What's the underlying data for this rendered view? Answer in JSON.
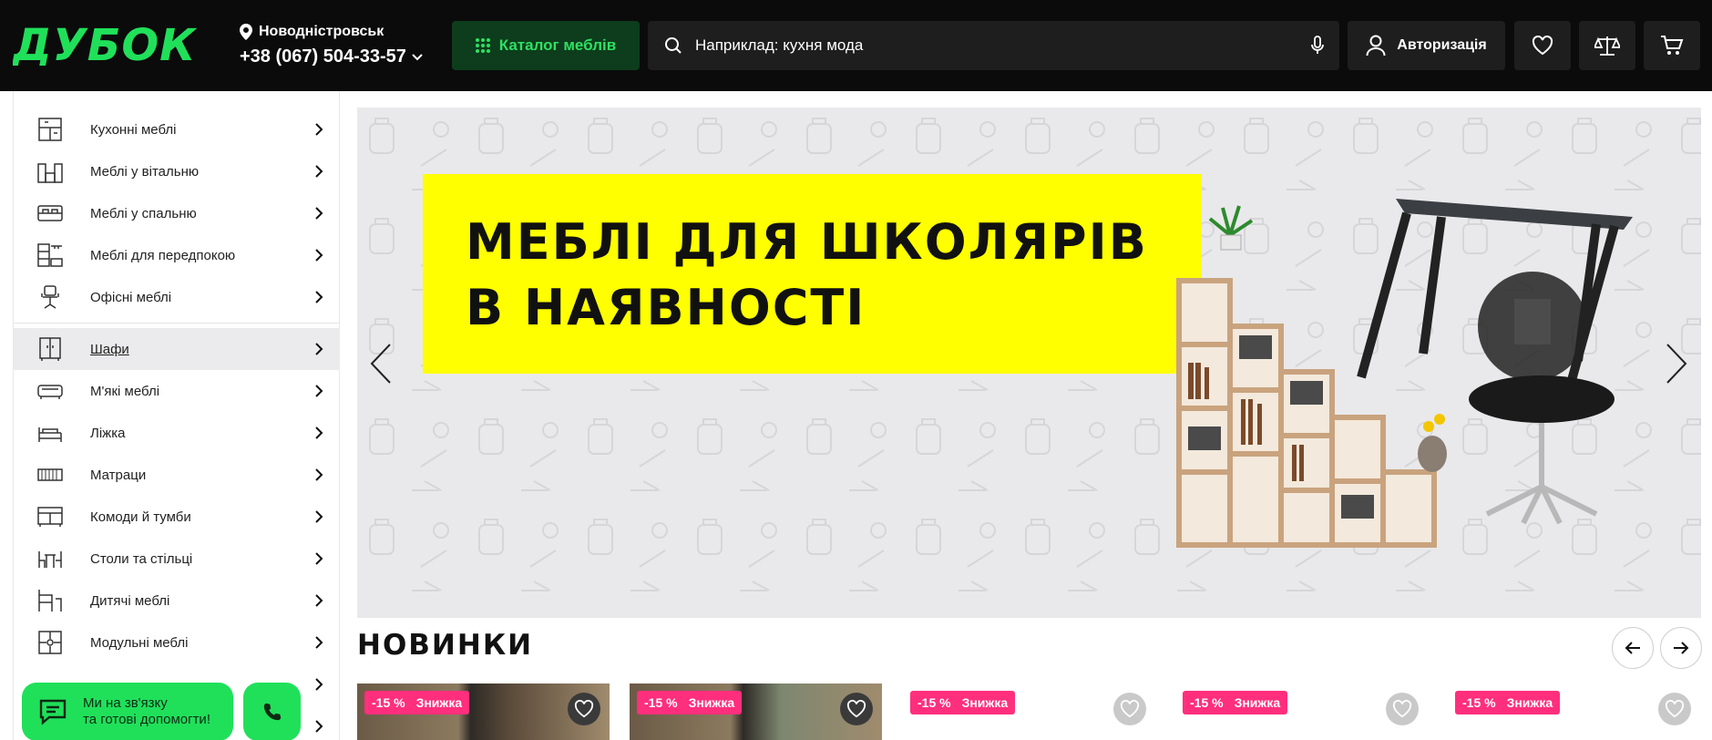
{
  "header": {
    "logo_text": "ДУБОК",
    "location": "Новодністровськ",
    "phone": "+38 (067) 504-33-57",
    "catalog_label": "Каталог меблів",
    "search_placeholder": "Наприклад: кухня мода",
    "auth_label": "Авторизація",
    "icons": [
      "location-pin-icon",
      "chevron-down-icon",
      "grid-icon",
      "search-icon",
      "microphone-icon",
      "user-icon",
      "heart-icon",
      "scales-icon",
      "cart-icon"
    ]
  },
  "colors": {
    "brand_green": "#20e05a",
    "header_bg": "#0b0b0b",
    "badge_pink": "#ff2f7d",
    "banner_yellow": "#ffff00"
  },
  "sidebar": {
    "items": [
      {
        "label": "Кухонні меблі",
        "icon": "kitchen-icon"
      },
      {
        "label": "Меблі у вітальню",
        "icon": "living-room-icon"
      },
      {
        "label": "Меблі у спальню",
        "icon": "bedroom-icon"
      },
      {
        "label": "Меблі для передпокою",
        "icon": "hallway-icon"
      },
      {
        "label": "Офісні меблі",
        "icon": "office-chair-icon"
      },
      {
        "label": "Шафи",
        "icon": "wardrobe-icon",
        "active": true
      },
      {
        "label": "М'які меблі",
        "icon": "sofa-icon"
      },
      {
        "label": "Ліжка",
        "icon": "bed-icon"
      },
      {
        "label": "Матраци",
        "icon": "mattress-icon"
      },
      {
        "label": "Комоди й тумби",
        "icon": "dresser-icon"
      },
      {
        "label": "Столи та стільці",
        "icon": "table-chairs-icon"
      },
      {
        "label": "Дитячі меблі",
        "icon": "kids-furniture-icon"
      },
      {
        "label": "Модульні меблі",
        "icon": "modular-icon"
      }
    ]
  },
  "banner": {
    "title_line1": "МЕБЛІ ДЛЯ ШКОЛЯРІВ",
    "title_line2": "В НАЯВНОСТІ"
  },
  "new_arrivals": {
    "title": "НОВИНКИ",
    "cards": [
      {
        "discount": "-15 %",
        "label": "Знижка"
      },
      {
        "discount": "-15 %",
        "label": "Знижка"
      },
      {
        "discount": "-15 %",
        "label": "Знижка"
      },
      {
        "discount": "-15 %",
        "label": "Знижка"
      },
      {
        "discount": "-15 %",
        "label": "Знижка"
      }
    ]
  },
  "chat": {
    "line1": "Ми на зв'язку",
    "line2": "та готові допомогти!"
  }
}
